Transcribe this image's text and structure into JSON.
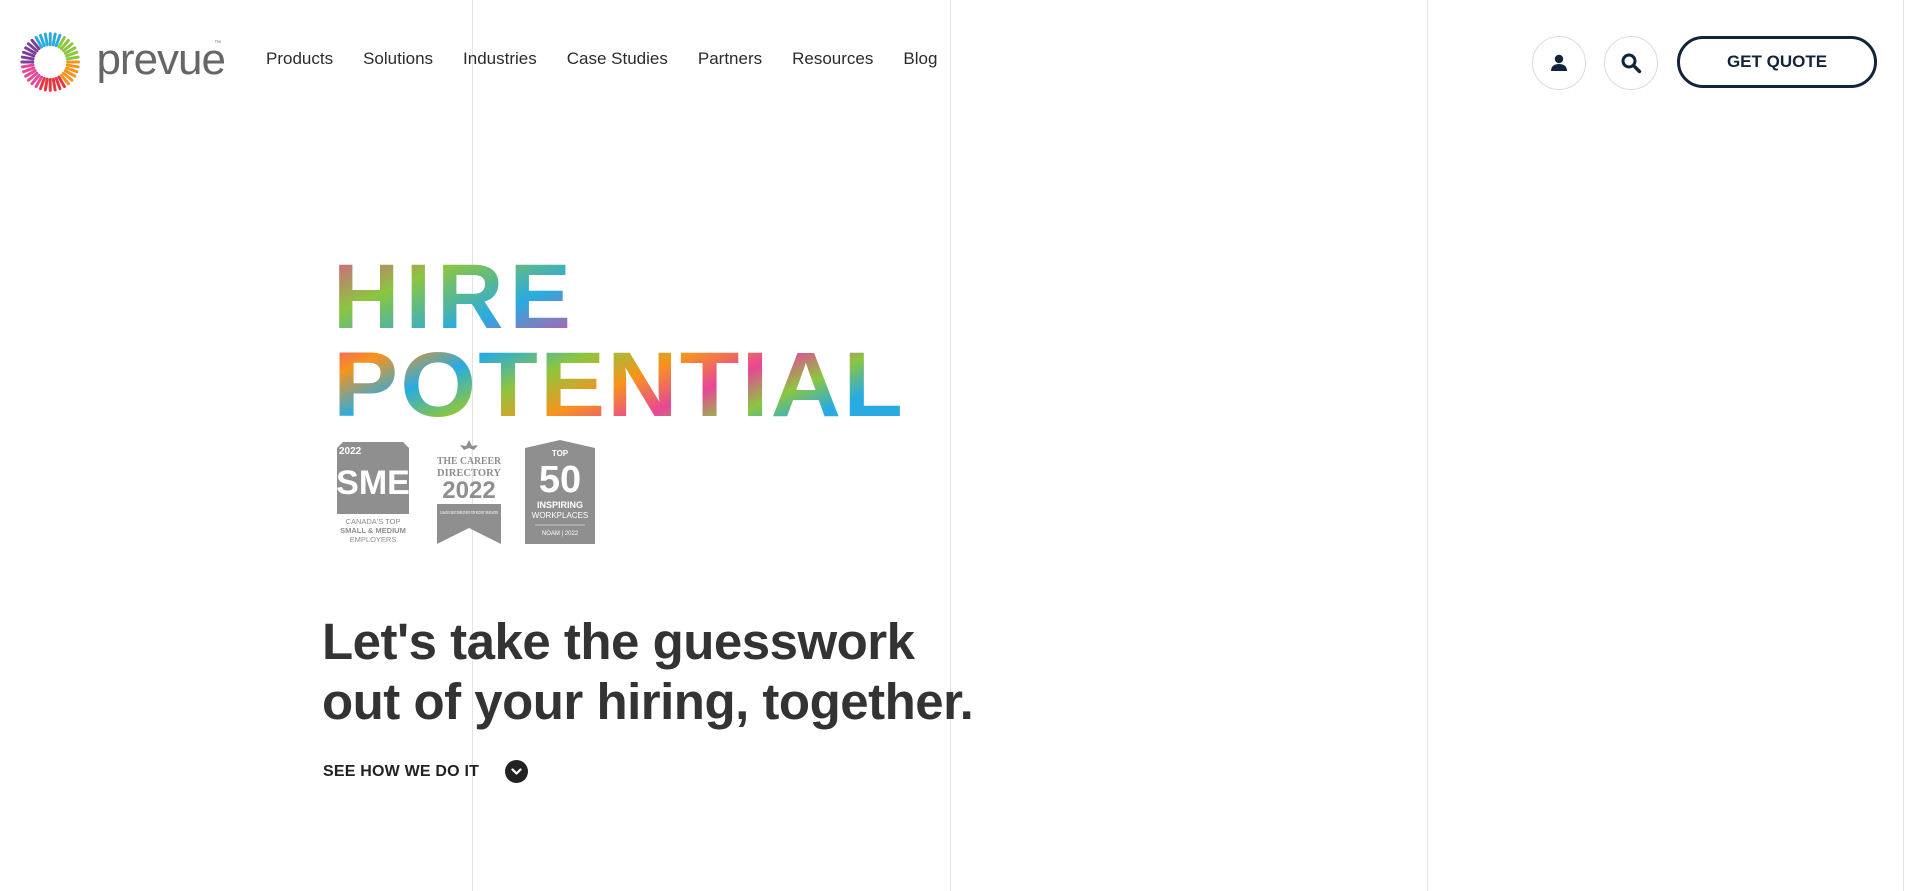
{
  "brand": {
    "name": "prevue",
    "tm": "™"
  },
  "nav": {
    "items": [
      {
        "label": "Products"
      },
      {
        "label": "Solutions"
      },
      {
        "label": "Industries"
      },
      {
        "label": "Case Studies"
      },
      {
        "label": "Partners"
      },
      {
        "label": "Resources"
      },
      {
        "label": "Blog"
      }
    ]
  },
  "header": {
    "account_icon": "user-icon",
    "search_icon": "search-icon",
    "quote_label": "GET QUOTE"
  },
  "hero": {
    "title_line1": "HIRE",
    "title_line2": "POTENTIAL",
    "awards": [
      {
        "year": "2022",
        "title": "SME",
        "sub1": "CANADA'S TOP",
        "sub2": "SMALL & MEDIUM",
        "sub3": "EMPLOYERS"
      },
      {
        "line1": "THE CAREER",
        "line2": "DIRECTORY",
        "year": "2022",
        "sub": "CANADA'S BEST EMPLOYERS FOR RECENT GRADUATES"
      },
      {
        "top": "TOP",
        "num": "50",
        "l1": "INSPIRING",
        "l2": "WORKPLACES",
        "foot": "NOAM | 2022"
      }
    ],
    "tagline_line1": "Let's take the guesswork",
    "tagline_line2": "out of your hiring, together.",
    "cta_label": "SEE HOW WE DO IT",
    "cta_icon": "chevron-down-icon"
  },
  "colors": {
    "pink": "#e64797",
    "blue": "#29abe2",
    "green": "#8cc63f",
    "orange": "#f7941d",
    "red": "#e8353f",
    "purple": "#7b3f98",
    "navy": "#13233a",
    "award_gray": "#8f8f8f"
  }
}
